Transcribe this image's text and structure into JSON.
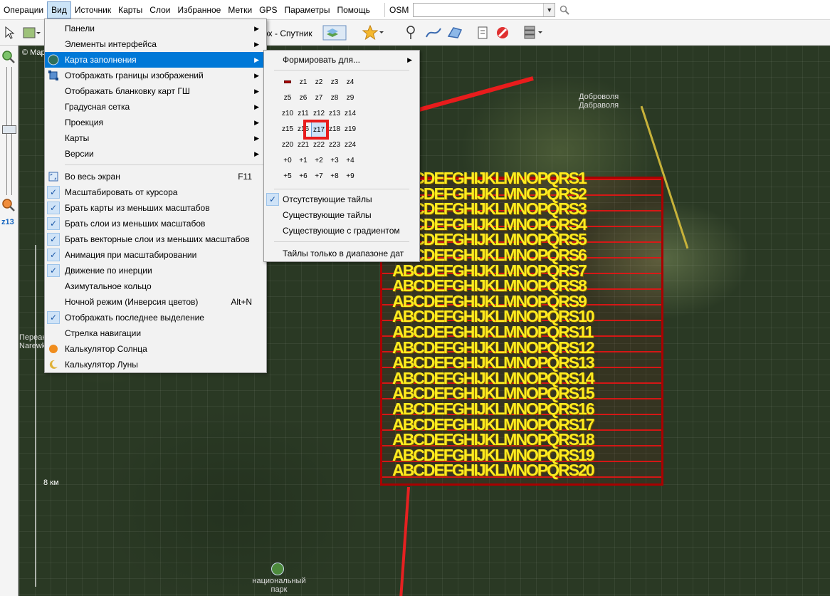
{
  "menubar": {
    "items": [
      "Операции",
      "Вид",
      "Источник",
      "Карты",
      "Слои",
      "Избранное",
      "Метки",
      "GPS",
      "Параметры",
      "Помощь"
    ],
    "map_label": "OSM"
  },
  "toolbar": {
    "layer_label": "ox - Спутник"
  },
  "map": {
    "copyright": "© Map",
    "scale_label": "8 км",
    "zoom_label": "z13",
    "village_1": "Доброволя",
    "village_2": "Дабраволя",
    "side_label_1": "Переак",
    "side_label_2": "Narewk",
    "poi_label_1": "национальный",
    "poi_label_2": "парк"
  },
  "tile_rows": [
    "ABCDEFGHIJKLMNOPQRS1",
    "ABCDEFGHIJKLMNOPQRS2",
    "ABCDEFGHIJKLMNOPQRS3",
    "ABCDEFGHIJKLMNOPQRS4",
    "ABCDEFGHIJKLMNOPQRS5",
    "ABCDEFGHIJKLMNOPQRS6",
    "ABCDEFGHIJKLMNOPQRS7",
    "ABCDEFGHIJKLMNOPQRS8",
    "ABCDEFGHIJKLMNOPQRS9",
    "ABCDEFGHIJKLMNOPQRS10",
    "ABCDEFGHIJKLMNOPQRS11",
    "ABCDEFGHIJKLMNOPQRS12",
    "ABCDEFGHIJKLMNOPQRS13",
    "ABCDEFGHIJKLMNOPQRS14",
    "ABCDEFGHIJKLMNOPQRS15",
    "ABCDEFGHIJKLMNOPQRS16",
    "ABCDEFGHIJKLMNOPQRS17",
    "ABCDEFGHIJKLMNOPQRS18",
    "ABCDEFGHIJKLMNOPQRS19",
    "ABCDEFGHIJKLMNOPQRS20"
  ],
  "view_menu": {
    "items": [
      {
        "label": "Панели",
        "submenu": true
      },
      {
        "label": "Элементы интерфейса",
        "submenu": true
      },
      {
        "label": "Карта заполнения",
        "submenu": true,
        "highlighted": true
      },
      {
        "label": "Отображать границы изображений",
        "submenu": true
      },
      {
        "label": "Отображать бланковку карт ГШ",
        "submenu": true
      },
      {
        "label": "Градусная сетка",
        "submenu": true
      },
      {
        "label": "Проекция",
        "submenu": true
      },
      {
        "label": "Карты",
        "submenu": true
      },
      {
        "label": "Версии",
        "submenu": true
      },
      {
        "label": "Во весь экран",
        "shortcut": "F11"
      },
      {
        "label": "Масштабировать от курсора",
        "checked": true
      },
      {
        "label": "Брать карты из меньших масштабов",
        "checked": true
      },
      {
        "label": "Брать слои из меньших масштабов",
        "checked": true
      },
      {
        "label": "Брать векторные слои из меньших масштабов",
        "checked": true
      },
      {
        "label": "Анимация при масштабировании",
        "checked": true
      },
      {
        "label": "Движение по инерции",
        "checked": true
      },
      {
        "label": "Азимутальное кольцо"
      },
      {
        "label": "Ночной режим (Инверсия цветов)",
        "shortcut": "Alt+N"
      },
      {
        "label": "Отображать последнее выделение",
        "checked": true
      },
      {
        "label": "Стрелка навигации"
      },
      {
        "label": "Калькулятор Солнца"
      },
      {
        "label": "Калькулятор Луны"
      }
    ]
  },
  "fill_submenu": {
    "generate_for": "Формировать для...",
    "zoom_rows": [
      [
        "",
        "z1",
        "z2",
        "z3",
        "z4"
      ],
      [
        "z5",
        "z6",
        "z7",
        "z8",
        "z9"
      ],
      [
        "z10",
        "z11",
        "z12",
        "z13",
        "z14"
      ],
      [
        "z15",
        "z16",
        "z17",
        "z18",
        "z19"
      ],
      [
        "z20",
        "z21",
        "z22",
        "z23",
        "z24"
      ],
      [
        "+0",
        "+1",
        "+2",
        "+3",
        "+4"
      ],
      [
        "+5",
        "+6",
        "+7",
        "+8",
        "+9"
      ]
    ],
    "selected_zoom": "z17",
    "missing_tiles": "Отсутствующие тайлы",
    "existing_tiles": "Существующие тайлы",
    "existing_gradient": "Существующие с градиентом",
    "date_range": "Тайлы только в диапазоне дат"
  }
}
